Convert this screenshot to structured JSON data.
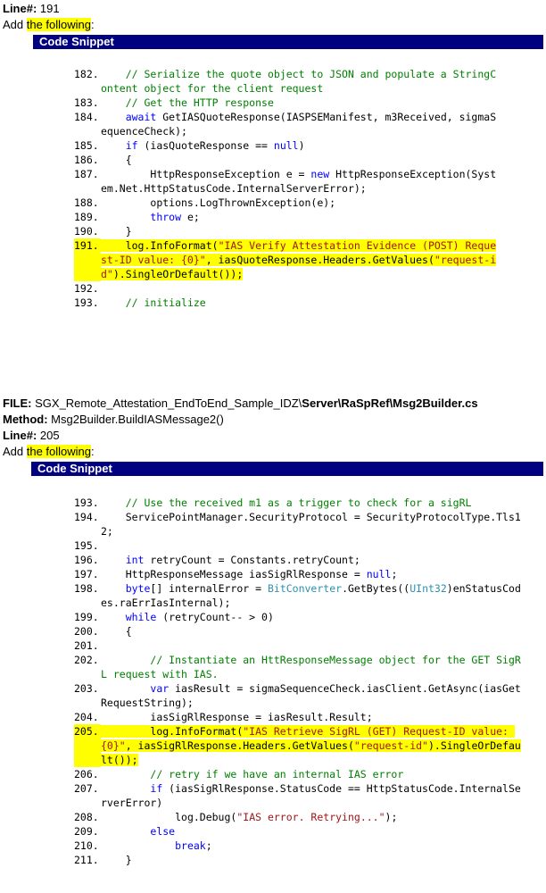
{
  "section1": {
    "line_label": "Line#:",
    "line_value": " 191",
    "add_prefix": "Add ",
    "add_highlight": "the following",
    "add_suffix": ":",
    "banner": "Code Snippet"
  },
  "snippet1": [
    {
      "n": "182.",
      "segs": [
        [
          "c",
          "    // Serialize the quote object to JSON and populate a StringContent object for the client request"
        ]
      ]
    },
    {
      "n": "183.",
      "segs": [
        [
          "c",
          "    // Get the HTTP response"
        ]
      ]
    },
    {
      "n": "184.",
      "segs": [
        [
          "t",
          "    "
        ],
        [
          "k",
          "await"
        ],
        [
          "t",
          " GetIASQuoteResponse(IASPSEManifest, m3Received, sigmaSequenceCheck);"
        ]
      ]
    },
    {
      "n": "185.",
      "segs": [
        [
          "t",
          "    "
        ],
        [
          "k",
          "if"
        ],
        [
          "t",
          " (iasQuoteResponse == "
        ],
        [
          "k",
          "null"
        ],
        [
          "t",
          ")"
        ]
      ]
    },
    {
      "n": "186.",
      "segs": [
        [
          "t",
          "    {"
        ]
      ]
    },
    {
      "n": "187.",
      "segs": [
        [
          "t",
          "        HttpResponseException e = "
        ],
        [
          "k",
          "new"
        ],
        [
          "t",
          " HttpResponseException(System.Net.HttpStatusCode.InternalServerError);"
        ]
      ]
    },
    {
      "n": "188.",
      "segs": [
        [
          "t",
          "        options.LogThrownException(e);"
        ]
      ]
    },
    {
      "n": "189.",
      "segs": [
        [
          "t",
          "        "
        ],
        [
          "k",
          "throw"
        ],
        [
          "t",
          " e;"
        ]
      ]
    },
    {
      "n": "190.",
      "segs": [
        [
          "t",
          "    }"
        ]
      ]
    },
    {
      "n": "191.",
      "hl": true,
      "segs": [
        [
          "t",
          "    log.InfoFormat("
        ],
        [
          "s",
          "\"IAS Verify Attestation Evidence (POST) Request-ID value: {0}\""
        ],
        [
          "t",
          ", iasQuoteResponse.Headers.GetValues("
        ],
        [
          "s",
          "\"request-id\""
        ],
        [
          "t",
          ").SingleOrDefault());"
        ]
      ]
    },
    {
      "n": "192.",
      "segs": [
        [
          "t",
          ""
        ]
      ]
    },
    {
      "n": "193.",
      "segs": [
        [
          "c",
          "    // initialize"
        ]
      ]
    }
  ],
  "section2": {
    "file_label": "FILE:",
    "file_path_1": " SGX_Remote_Attestation_EndToEnd_Sample_IDZ\\",
    "file_path_2": "Server\\RaSpRef\\Msg2Builder.cs",
    "method_label": "Method:",
    "method_value": " Msg2Builder.BuildIASMessage2()",
    "line_label": "Line#:",
    "line_value": " 205",
    "add_prefix": "Add ",
    "add_highlight": "the following",
    "add_suffix": ":",
    "banner": "Code Snippet"
  },
  "snippet2": [
    {
      "n": "193.",
      "segs": [
        [
          "c",
          "    // Use the received m1 as a trigger to check for a sigRL"
        ]
      ]
    },
    {
      "n": "194.",
      "segs": [
        [
          "t",
          "    ServicePointManager.SecurityProtocol = SecurityProtocolType.Tls12;"
        ]
      ]
    },
    {
      "n": "195.",
      "segs": [
        [
          "t",
          ""
        ]
      ]
    },
    {
      "n": "196.",
      "segs": [
        [
          "t",
          "    "
        ],
        [
          "k",
          "int"
        ],
        [
          "t",
          " retryCount = Constants.retryCount;"
        ]
      ]
    },
    {
      "n": "197.",
      "segs": [
        [
          "t",
          "    HttpResponseMessage iasSigRlResponse = "
        ],
        [
          "k",
          "null"
        ],
        [
          "t",
          ";"
        ]
      ]
    },
    {
      "n": "198.",
      "segs": [
        [
          "t",
          "    "
        ],
        [
          "k",
          "byte"
        ],
        [
          "t",
          "[] internalError = "
        ],
        [
          "y",
          "BitConverter"
        ],
        [
          "t",
          ".GetBytes(("
        ],
        [
          "y",
          "UInt32"
        ],
        [
          "t",
          ")enStatusCodes.raErrIasInternal);"
        ]
      ]
    },
    {
      "n": "199.",
      "segs": [
        [
          "t",
          "    "
        ],
        [
          "k",
          "while"
        ],
        [
          "t",
          " (retryCount-- > 0)"
        ]
      ]
    },
    {
      "n": "200.",
      "segs": [
        [
          "t",
          "    {"
        ]
      ]
    },
    {
      "n": "201.",
      "segs": [
        [
          "t",
          ""
        ]
      ]
    },
    {
      "n": "202.",
      "segs": [
        [
          "c",
          "        // Instantiate an HttResponseMessage object for the GET SigRL request with IAS."
        ]
      ]
    },
    {
      "n": "203.",
      "segs": [
        [
          "t",
          "        "
        ],
        [
          "k",
          "var"
        ],
        [
          "t",
          " iasResult = sigmaSequenceCheck.iasClient.GetAsync(iasGetRequestString);"
        ]
      ]
    },
    {
      "n": "204.",
      "segs": [
        [
          "t",
          "        iasSigRlResponse = iasResult.Result;"
        ]
      ]
    },
    {
      "n": "205.",
      "hl": true,
      "segs": [
        [
          "t",
          "        log.InfoFormat("
        ],
        [
          "s",
          "\"IAS Retrieve SigRL (GET) Request-ID value: {0}\""
        ],
        [
          "t",
          ", iasSigRlResponse.Headers.GetValues("
        ],
        [
          "s",
          "\"request-id\""
        ],
        [
          "t",
          ").SingleOrDefault());"
        ]
      ]
    },
    {
      "n": "206.",
      "segs": [
        [
          "c",
          "        // retry if we have an internal IAS error"
        ]
      ]
    },
    {
      "n": "207.",
      "segs": [
        [
          "t",
          "        "
        ],
        [
          "k",
          "if"
        ],
        [
          "t",
          " (iasSigRlResponse.StatusCode == HttpStatusCode.InternalServerError)"
        ]
      ]
    },
    {
      "n": "208.",
      "segs": [
        [
          "t",
          "            log.Debug("
        ],
        [
          "s",
          "\"IAS error. Retrying...\""
        ],
        [
          "t",
          ");"
        ]
      ]
    },
    {
      "n": "209.",
      "segs": [
        [
          "t",
          "        "
        ],
        [
          "k",
          "else"
        ]
      ]
    },
    {
      "n": "210.",
      "segs": [
        [
          "t",
          "            "
        ],
        [
          "k",
          "break"
        ],
        [
          "t",
          ";"
        ]
      ]
    },
    {
      "n": "211.",
      "segs": [
        [
          "t",
          "    }"
        ]
      ]
    }
  ]
}
